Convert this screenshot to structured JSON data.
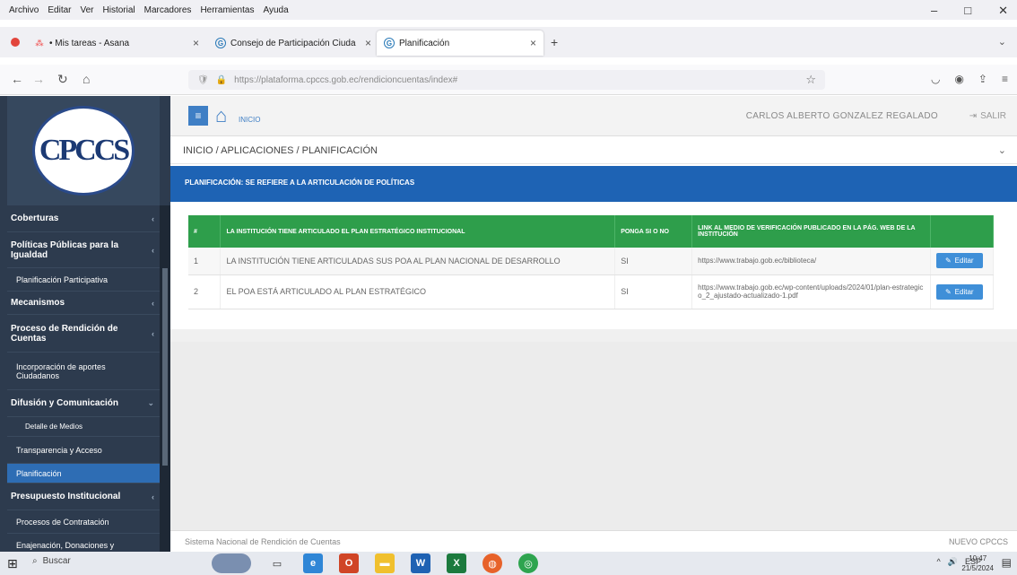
{
  "browser": {
    "menu": [
      "Archivo",
      "Editar",
      "Ver",
      "Historial",
      "Marcadores",
      "Herramientas",
      "Ayuda"
    ],
    "tabs": [
      {
        "label": "• Mis tareas - Asana"
      },
      {
        "label": "Consejo de Participación Ciuda"
      },
      {
        "label": "Planificación"
      }
    ],
    "new_tab": "+",
    "url": "https://plataforma.cpccs.gob.ec/rendicioncuentas/index#"
  },
  "app": {
    "logo_text": "CPCCS",
    "home_label": "INICIO",
    "user_name": "CARLOS ALBERTO GONZALEZ REGALADO",
    "logout_label": "SALIR",
    "breadcrumb": "INICIO / APLICACIONES / PLANIFICACIÓN",
    "banner": "PLANIFICACIÓN: SE REFIERE A LA ARTICULACIÓN DE POLÍTICAS"
  },
  "sidebar": {
    "items": [
      {
        "label": "Coberturas",
        "level": 0,
        "chevron": true
      },
      {
        "label": "Políticas Públicas para la Igualdad",
        "level": 0,
        "chevron": true
      },
      {
        "label": "Planificación Participativa",
        "level": 1,
        "chevron": false
      },
      {
        "label": "Mecanismos",
        "level": 0,
        "chevron": true
      },
      {
        "label": "Proceso de Rendición de Cuentas",
        "level": 0,
        "chevron": true
      },
      {
        "label": "Incorporación de aportes Ciudadanos",
        "level": 1,
        "chevron": false
      },
      {
        "label": "Difusión y Comunicación",
        "level": 0,
        "chevron": true
      },
      {
        "label": "Detalle de Medios",
        "level": 2,
        "chevron": false
      },
      {
        "label": "Transparencia y Acceso",
        "level": 1,
        "chevron": false
      },
      {
        "label": "Planificación",
        "level": 1,
        "chevron": false,
        "active": true
      },
      {
        "label": "Presupuesto Institucional",
        "level": 0,
        "chevron": true
      },
      {
        "label": "Procesos de Contratación",
        "level": 1,
        "chevron": false
      },
      {
        "label": "Enajenación, Donaciones y",
        "level": 1,
        "chevron": false
      }
    ]
  },
  "table": {
    "headers": [
      "#",
      "LA INSTITUCIÓN TIENE ARTICULADO EL PLAN ESTRATÉGICO INSTITUCIONAL",
      "PONGA SI O NO",
      "LINK AL MEDIO DE VERIFICACIÓN PUBLICADO EN LA PÁG. WEB DE LA INSTITUCIÓN",
      ""
    ],
    "rows": [
      {
        "num": "1",
        "description": "LA INSTITUCIÓN TIENE ARTICULADAS SUS POA AL PLAN NACIONAL DE DESARROLLO",
        "answer": "SI",
        "link": "https://www.trabajo.gob.ec/biblioteca/",
        "action": "Editar"
      },
      {
        "num": "2",
        "description": "EL POA ESTÁ ARTICULADO AL PLAN ESTRATÉGICO",
        "answer": "SI",
        "link": "https://www.trabajo.gob.ec/wp-content/uploads/2024/01/plan-estrategico_2_ajustado-actualizado-1.pdf",
        "action": "Editar"
      }
    ]
  },
  "footer": {
    "left": "Sistema Nacional de Rendición de Cuentas",
    "right": "NUEVO CPCCS"
  },
  "taskbar": {
    "search_label": "Buscar",
    "tray_lang": "ESP",
    "time": "10:47",
    "date": "21/5/2024"
  }
}
